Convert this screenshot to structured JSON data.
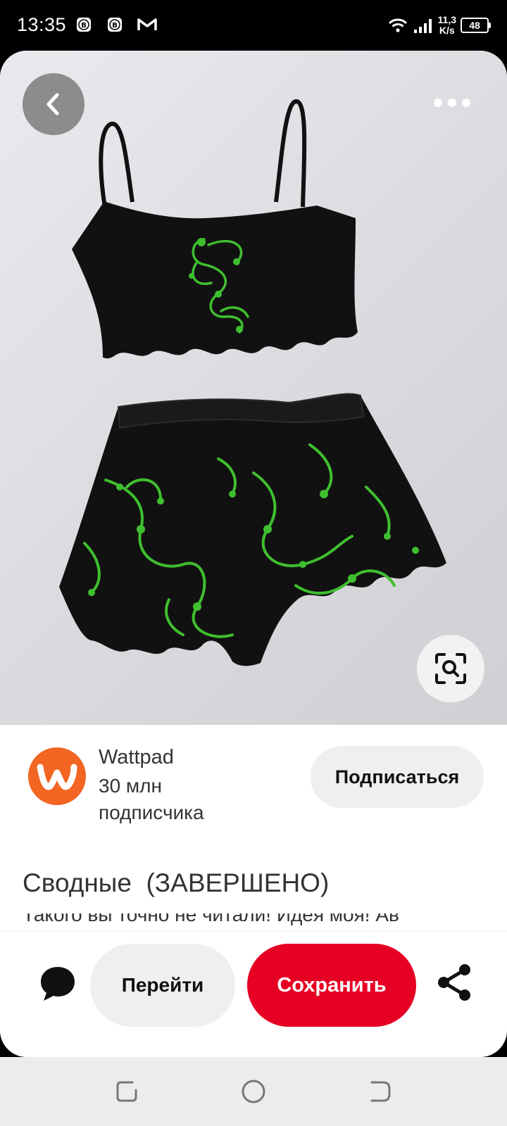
{
  "status_bar": {
    "time": "13:35",
    "notifications": [
      "badge-icon",
      "badge-icon",
      "gmail-icon"
    ],
    "net_speed_value": "11,3",
    "net_speed_unit": "K/s",
    "battery": "48"
  },
  "pin": {
    "icons": {
      "back": "chevron-left-icon",
      "more": "more-dots-icon",
      "lens": "visual-search-icon"
    },
    "image_description_colors": {
      "accent": "#3fbf2f",
      "fabric": "#111111"
    }
  },
  "profile": {
    "name": "Wattpad",
    "followers": "30 млн подписчика",
    "subscribe_label": "Подписаться",
    "avatar_color": "#f26522"
  },
  "title": "Сводные  (ЗАВЕРШЕНО)",
  "description": "Такого вы точно не читали! Идея моя! Ав",
  "actions": {
    "go_label": "Перейти",
    "save_label": "Сохранить",
    "save_color": "#e60023"
  }
}
